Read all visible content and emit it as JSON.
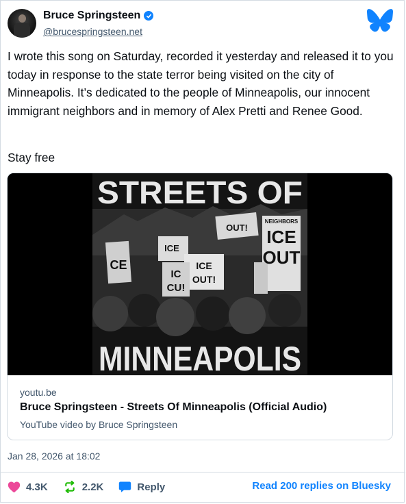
{
  "author": {
    "name": "Bruce Springsteen",
    "handle": "@brucespringsteen.net"
  },
  "post": {
    "text": "I wrote this song on Saturday, recorded it yesterday and released it to you today in response to the state terror being visited on the city of Minneapolis. It’s dedicated to the people of Minneapolis, our innocent immigrant neighbors and in memory of Alex Pretti and Renee Good.",
    "signoff": "Stay free",
    "timestamp": "Jan 28, 2026 at 18:02"
  },
  "embed": {
    "thumbnail_top_text": "STREETS OF",
    "thumbnail_bottom_text": "MINNEAPOLIS",
    "thumbnail_signs": [
      "ICE OUT!",
      "ICE",
      "ICE OUT!",
      "IC CU!",
      "NEIGHBORS"
    ],
    "domain": "youtu.be",
    "title": "Bruce Springsteen - Streets Of Minneapolis (Official Audio)",
    "description": "YouTube video by Bruce Springsteen"
  },
  "actions": {
    "likes": "4.3K",
    "reposts": "2.2K",
    "reply_label": "Reply",
    "read_replies": "Read 200 replies on Bluesky"
  },
  "colors": {
    "accent": "#1083fe",
    "like": "#ec4899",
    "repost": "#20bc07",
    "muted": "#42576c"
  },
  "icons": {
    "verified": "verified-check-icon",
    "logo": "bluesky-butterfly-icon",
    "like": "heart-icon",
    "repost": "repost-icon",
    "reply": "reply-bubble-icon"
  }
}
